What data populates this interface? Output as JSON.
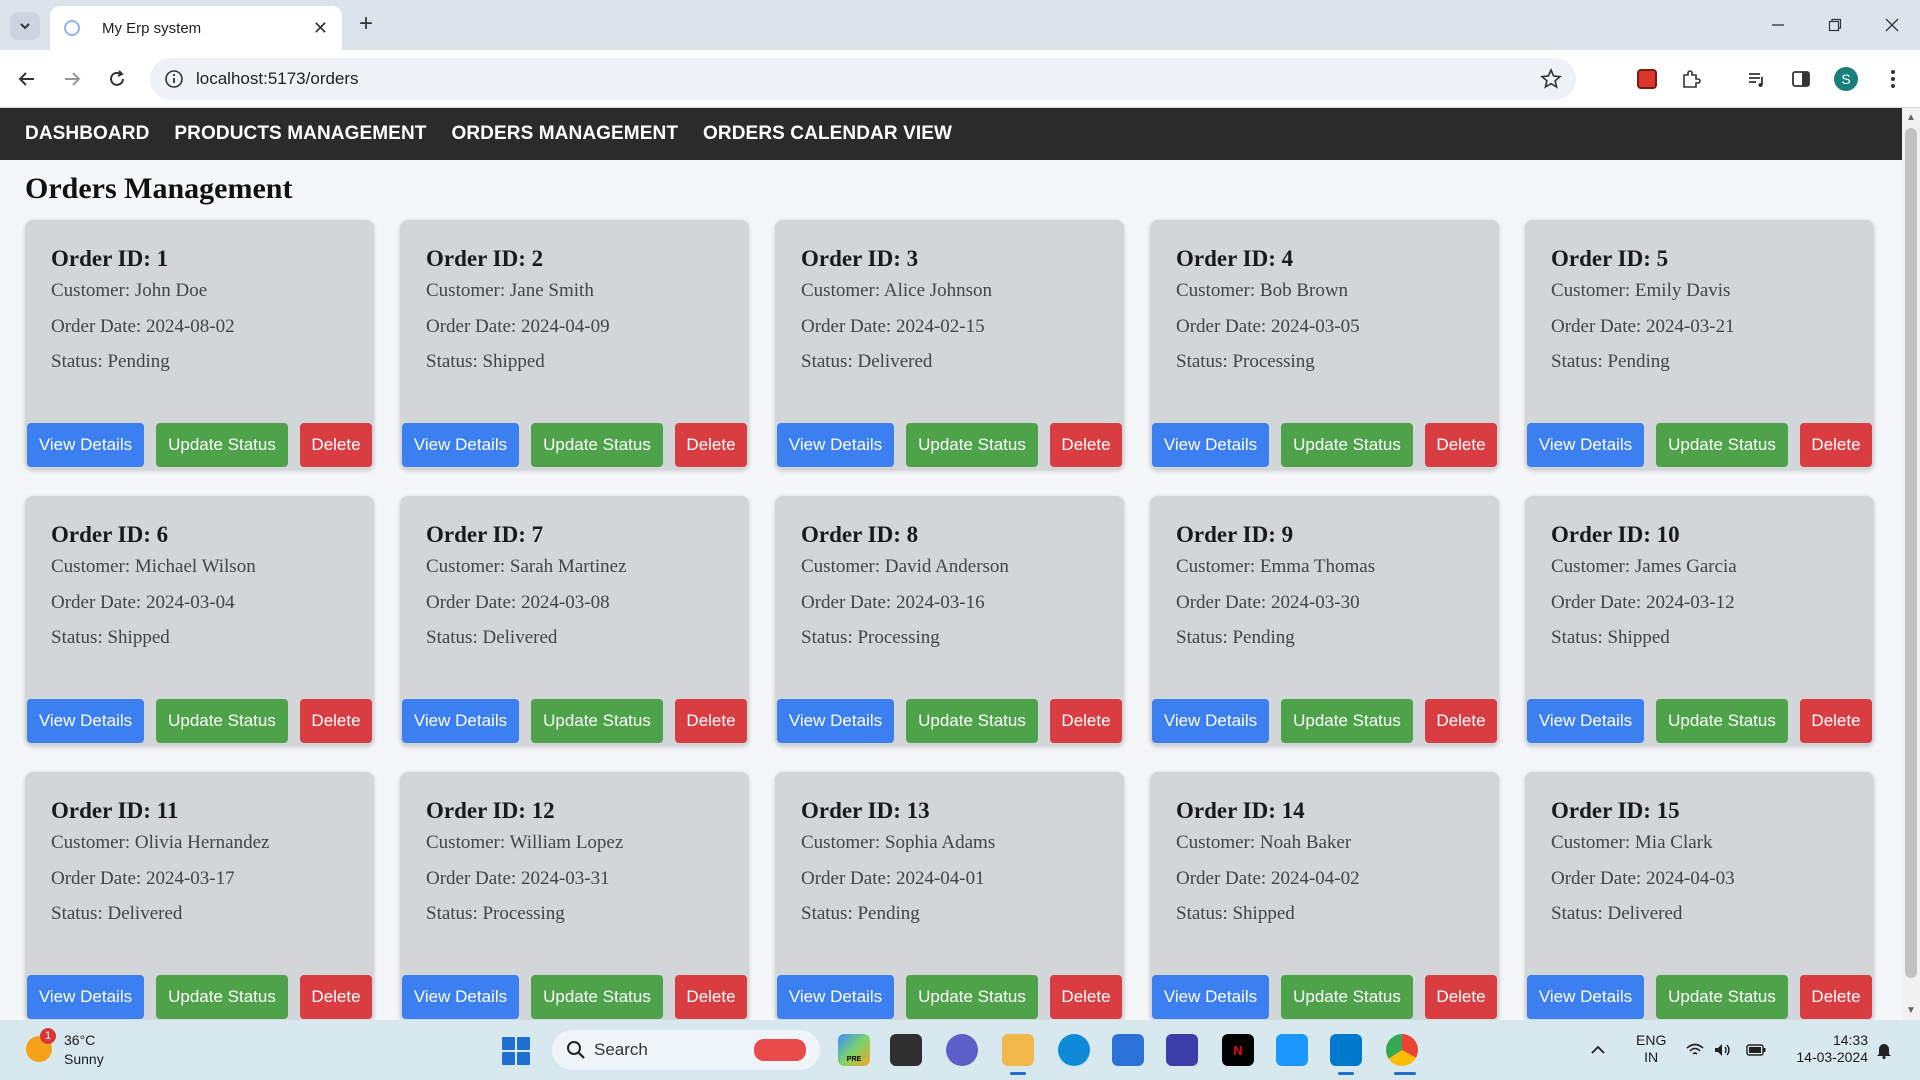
{
  "browser": {
    "tab_title": "My Erp system",
    "url": "localhost:5173/orders"
  },
  "nav": [
    "DASHBOARD",
    "PRODUCTS MANAGEMENT",
    "ORDERS MANAGEMENT",
    "ORDERS CALENDAR VIEW"
  ],
  "page": {
    "title": "Orders Management"
  },
  "card_buttons": {
    "view": "View Details",
    "update": "Update Status",
    "delete": "Delete"
  },
  "orders": [
    {
      "title": "Order ID: 1",
      "customer": "Customer: John Doe",
      "date": "Order Date: 2024-08-02",
      "status": "Status: Pending"
    },
    {
      "title": "Order ID: 2",
      "customer": "Customer: Jane Smith",
      "date": "Order Date: 2024-04-09",
      "status": "Status: Shipped"
    },
    {
      "title": "Order ID: 3",
      "customer": "Customer: Alice Johnson",
      "date": "Order Date: 2024-02-15",
      "status": "Status: Delivered"
    },
    {
      "title": "Order ID: 4",
      "customer": "Customer: Bob Brown",
      "date": "Order Date: 2024-03-05",
      "status": "Status: Processing"
    },
    {
      "title": "Order ID: 5",
      "customer": "Customer: Emily Davis",
      "date": "Order Date: 2024-03-21",
      "status": "Status: Pending"
    },
    {
      "title": "Order ID: 6",
      "customer": "Customer: Michael Wilson",
      "date": "Order Date: 2024-03-04",
      "status": "Status: Shipped"
    },
    {
      "title": "Order ID: 7",
      "customer": "Customer: Sarah Martinez",
      "date": "Order Date: 2024-03-08",
      "status": "Status: Delivered"
    },
    {
      "title": "Order ID: 8",
      "customer": "Customer: David Anderson",
      "date": "Order Date: 2024-03-16",
      "status": "Status: Processing"
    },
    {
      "title": "Order ID: 9",
      "customer": "Customer: Emma Thomas",
      "date": "Order Date: 2024-03-30",
      "status": "Status: Pending"
    },
    {
      "title": "Order ID: 10",
      "customer": "Customer: James Garcia",
      "date": "Order Date: 2024-03-12",
      "status": "Status: Shipped"
    },
    {
      "title": "Order ID: 11",
      "customer": "Customer: Olivia Hernandez",
      "date": "Order Date: 2024-03-17",
      "status": "Status: Delivered"
    },
    {
      "title": "Order ID: 12",
      "customer": "Customer: William Lopez",
      "date": "Order Date: 2024-03-31",
      "status": "Status: Processing"
    },
    {
      "title": "Order ID: 13",
      "customer": "Customer: Sophia Adams",
      "date": "Order Date: 2024-04-01",
      "status": "Status: Pending"
    },
    {
      "title": "Order ID: 14",
      "customer": "Customer: Noah Baker",
      "date": "Order Date: 2024-04-02",
      "status": "Status: Shipped"
    },
    {
      "title": "Order ID: 15",
      "customer": "Customer: Mia Clark",
      "date": "Order Date: 2024-04-03",
      "status": "Status: Delivered"
    }
  ],
  "taskbar": {
    "weather_temp": "36°C",
    "weather_cond": "Sunny",
    "weather_badge": "1",
    "search_label": "Search",
    "lang_line1": "ENG",
    "lang_line2": "IN",
    "time": "14:33",
    "date": "14-03-2024",
    "pre_badge": "PRE"
  },
  "profile_initial": "S",
  "colors": {
    "nav_bg": "#2b2b2b",
    "card_bg": "#d2d6d9",
    "view_btn": "#3b7ff0",
    "update_btn": "#4ea24a",
    "delete_btn": "#d93c41"
  },
  "icons": [
    "tab-search-icon",
    "favicon-icon",
    "tab-close-icon",
    "new-tab-icon",
    "minimize-icon",
    "restore-icon",
    "close-window-icon",
    "back-icon",
    "forward-icon",
    "reload-icon",
    "site-info-icon",
    "bookmark-star-icon",
    "extension-red-icon",
    "puzzle-icon",
    "media-control-icon",
    "side-panel-icon",
    "more-menu-icon"
  ]
}
